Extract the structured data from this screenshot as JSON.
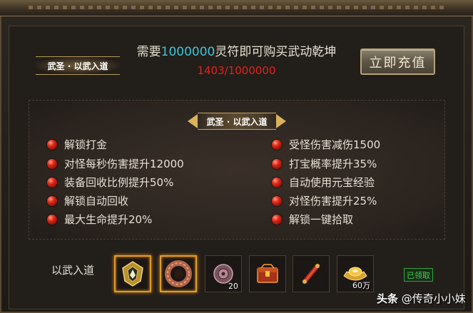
{
  "header": {
    "need_prefix": "需要",
    "need_amount": "1000000",
    "need_suffix": "灵符即可购买武动乾坤",
    "progress": "1403/1000000",
    "banner_left": "武圣 · 以武入道",
    "recharge_button": "立即充值"
  },
  "panel": {
    "title": "武圣 · 以武入道",
    "perks_left": [
      "解锁打金",
      "对怪每秒伤害提升12000",
      "装备回收比例提升50%",
      "解锁自动回收",
      "最大生命提升20%"
    ],
    "perks_right": [
      "受怪伤害减伤1500",
      "打宝概率提升35%",
      "自动使用元宝经验",
      "对怪伤害提升25%",
      "解锁一键拾取"
    ]
  },
  "rewards": {
    "label": "以武入道",
    "items": [
      {
        "icon": "golden-emblem-icon",
        "count": "",
        "highlighted": true
      },
      {
        "icon": "bronze-ring-icon",
        "count": "",
        "highlighted": true
      },
      {
        "icon": "purple-gem-icon",
        "count": "20",
        "highlighted": false
      },
      {
        "icon": "red-treasure-box-icon",
        "count": "",
        "highlighted": false
      },
      {
        "icon": "red-scroll-icon",
        "count": "",
        "highlighted": false
      },
      {
        "icon": "gold-ingot-icon",
        "count": "60万",
        "highlighted": false
      }
    ],
    "status": "已领取"
  },
  "watermark": {
    "source": "头条",
    "handle": "@传奇小小妹"
  },
  "colors": {
    "accent_cyan": "#39c7d6",
    "progress_red": "#e2231a",
    "claimed_green": "#3fd04a",
    "highlight_orange": "#e19a2a"
  }
}
